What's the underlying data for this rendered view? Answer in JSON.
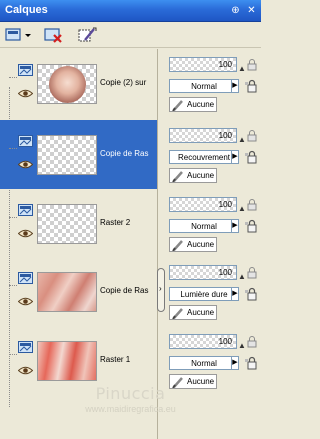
{
  "window": {
    "title": "Calques",
    "pin_glyph": "⊕",
    "close_glyph": "✕",
    "pin_label": "pin-icon",
    "close_label": "close-icon"
  },
  "toolbar": {
    "tools": [
      "layers-panel-icon",
      "delete-layer-icon",
      "edit-layer-icon"
    ]
  },
  "layers": [
    {
      "name": "Copie (2) sur",
      "thumb": "round",
      "selected": false
    },
    {
      "name": "Copie de Ras",
      "thumb": "checker",
      "selected": true
    },
    {
      "name": "Raster 2",
      "thumb": "checker",
      "selected": false
    },
    {
      "name": "Copie de Ras",
      "thumb": "pink",
      "selected": false
    },
    {
      "name": "Raster 1",
      "thumb": "red",
      "selected": false
    }
  ],
  "properties": [
    {
      "opacity": "100",
      "blend": "Normal",
      "mask": "Aucune"
    },
    {
      "opacity": "100",
      "blend": "Recouvrement",
      "mask": "Aucune"
    },
    {
      "opacity": "100",
      "blend": "Normal",
      "mask": "Aucune"
    },
    {
      "opacity": "100",
      "blend": "Lumière dure",
      "mask": "Aucune"
    },
    {
      "opacity": "100",
      "blend": "Normal",
      "mask": "Aucune"
    }
  ],
  "watermark": {
    "line1": "Pinuccia",
    "line2": "www.maidiregrafica.eu"
  },
  "colors": {
    "title_bar": "#2a6bd8",
    "selection": "#316ac5",
    "panel": "#ece9d8"
  }
}
